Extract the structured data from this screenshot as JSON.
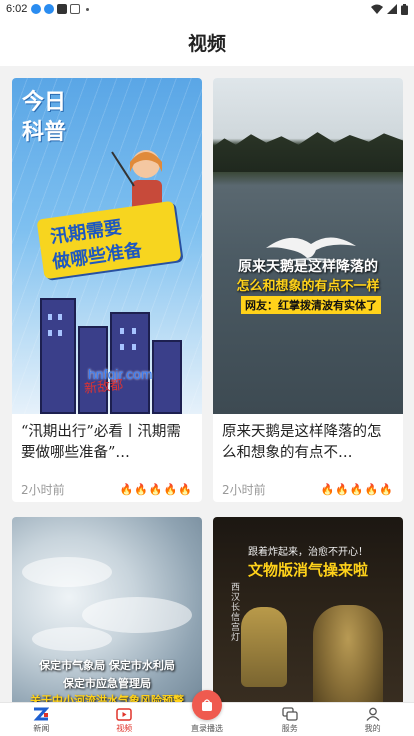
{
  "status_bar": {
    "time": "6:02",
    "icons": [
      "notification-blue-icon",
      "notification-blue-icon",
      "app-dark-icon",
      "box-outline-icon",
      "dot-icon"
    ],
    "right_icons": [
      "wifi-icon",
      "signal-icon",
      "battery-icon"
    ]
  },
  "header": {
    "title": "视频"
  },
  "videos": [
    {
      "title": "“汛期出行”必看丨汛期需要做哪些准备”…",
      "time": "2小时前",
      "thumb": {
        "logo_top": "今日",
        "logo_bottom": "科普",
        "banner_line1": "汛期需要",
        "banner_line2": "做哪些准备",
        "watermark_url": "hnfqjr.com",
        "watermark_seal": "新敌都"
      }
    },
    {
      "title": "原来天鹅是这样降落的怎么和想象的有点不…",
      "time": "2小时前",
      "thumb": {
        "caption1": "原来天鹅是这样降落的",
        "caption2": "怎么和想象的有点不一样",
        "caption3": "网友：红掌拨清波有实体了"
      }
    },
    {
      "title": "",
      "time": "",
      "thumb": {
        "line1": "保定市气象局 保定市水利局",
        "line2": "保定市应急管理局",
        "line3": "关于中小河流洪水气象风险预警"
      }
    },
    {
      "title": "",
      "time": "",
      "thumb": {
        "line1": "跟着炸起来，治愈不开心！",
        "line2": "文物版消气操来啦",
        "lamp_label": "西汉长信宫灯"
      }
    }
  ],
  "flames": "🔥🔥🔥🔥🔥",
  "tabbar": {
    "tabs": [
      {
        "label": "新闻",
        "icon": "news-logo-icon",
        "active": false
      },
      {
        "label": "视频",
        "icon": "video-play-icon",
        "active": true
      },
      {
        "label": "直录播选",
        "icon": "live-bag-icon",
        "active": false
      },
      {
        "label": "服务",
        "icon": "service-chat-icon",
        "active": false
      },
      {
        "label": "我的",
        "icon": "user-profile-icon",
        "active": false
      }
    ]
  },
  "colors": {
    "accent": "#e0332a",
    "live_button": "#ef5a4f",
    "banner_yellow": "#f7d51f"
  }
}
